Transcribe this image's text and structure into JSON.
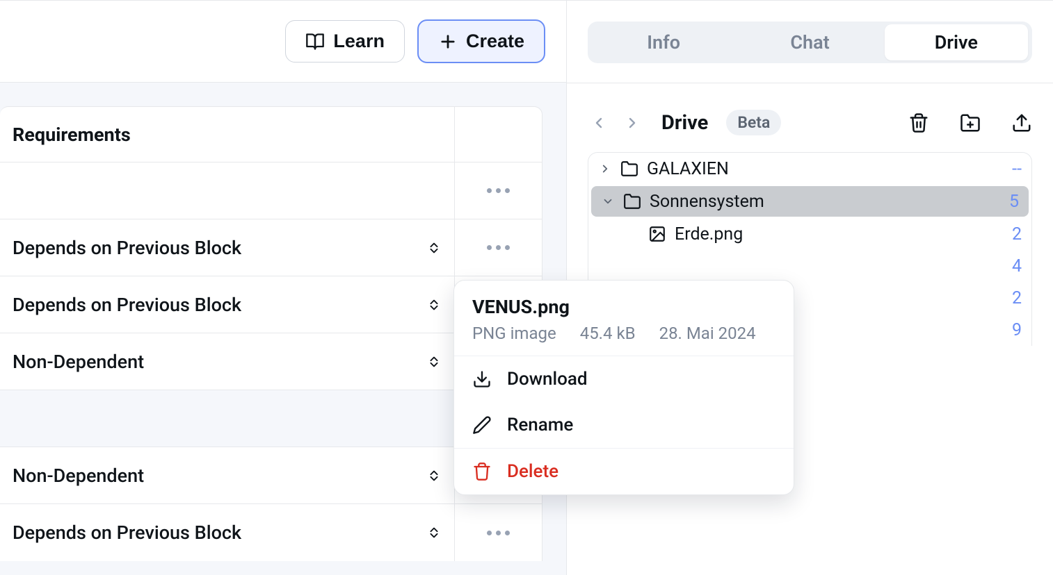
{
  "header": {
    "learn_label": "Learn",
    "create_label": "Create"
  },
  "requirements": {
    "title": "Requirements",
    "rows": [
      {
        "label": ""
      },
      {
        "label": "Depends on Previous Block"
      },
      {
        "label": "Depends on Previous Block"
      },
      {
        "label": "Non-Dependent"
      },
      {
        "label": "Non-Dependent"
      },
      {
        "label": "Depends on Previous Block"
      }
    ]
  },
  "tabs": {
    "info": "Info",
    "chat": "Chat",
    "drive": "Drive"
  },
  "drive": {
    "title": "Drive",
    "beta": "Beta",
    "tree": [
      {
        "name": "GALAXIEN",
        "count": "--"
      },
      {
        "name": "Sonnensystem",
        "count": "5"
      },
      {
        "name": "Erde.png",
        "count": "2"
      },
      {
        "name": "",
        "count": "4"
      },
      {
        "name": "",
        "count": "2"
      },
      {
        "name": "",
        "count": "9"
      }
    ]
  },
  "context_menu": {
    "file_name": "VENUS.png",
    "file_type": "PNG image",
    "file_size": "45.4 kB",
    "file_date": "28. Mai 2024",
    "download": "Download",
    "rename": "Rename",
    "delete": "Delete"
  }
}
